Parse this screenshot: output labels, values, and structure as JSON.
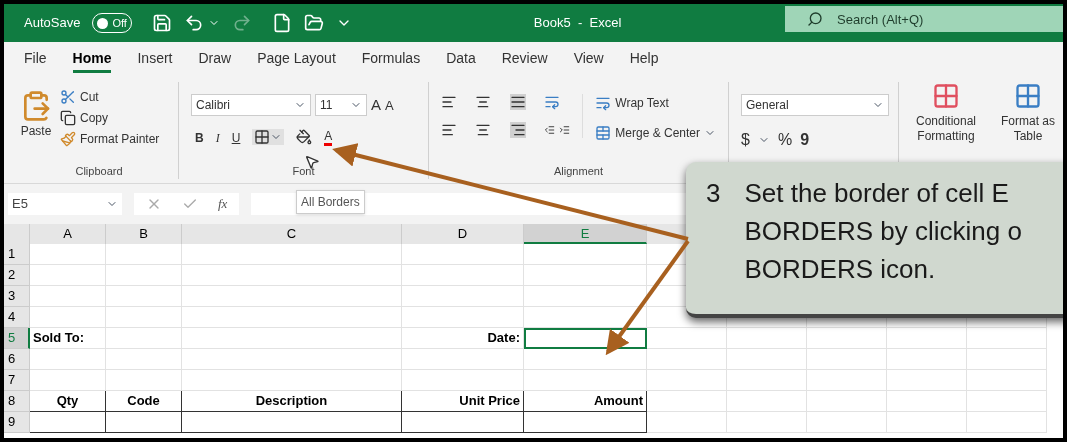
{
  "title_bar": {
    "autosave": "AutoSave",
    "autosave_toggle": {
      "label": "Off",
      "on": false
    },
    "title": "Book5  -  Excel",
    "search": {
      "placeholder": "Search (Alt+Q)"
    }
  },
  "tabs": [
    {
      "label": "File",
      "selected": false
    },
    {
      "label": "Home",
      "selected": true
    },
    {
      "label": "Insert",
      "selected": false
    },
    {
      "label": "Draw",
      "selected": false
    },
    {
      "label": "Page Layout",
      "selected": false
    },
    {
      "label": "Formulas",
      "selected": false
    },
    {
      "label": "Data",
      "selected": false
    },
    {
      "label": "Review",
      "selected": false
    },
    {
      "label": "View",
      "selected": false
    },
    {
      "label": "Help",
      "selected": false
    }
  ],
  "ribbon": {
    "clipboard": {
      "paste": "Paste",
      "cut": "Cut",
      "copy": "Copy",
      "format_painter": "Format Painter",
      "label": "Clipboard"
    },
    "font": {
      "font_name": "Calibri",
      "font_size": "11",
      "grow_font": "A",
      "shrink_font": "A",
      "font_color": "A",
      "bold": "B",
      "italic": "I",
      "underline": "U",
      "label": "Font"
    },
    "alignment": {
      "wrap_text": "Wrap Text",
      "merge_center": "Merge & Center",
      "label": "Alignment"
    },
    "number": {
      "format": "General",
      "currency": "$",
      "percent": "%",
      "comma": "9"
    },
    "styles": {
      "conditional_formatting": "Conditional Formatting",
      "format_as_table": "Format as Table"
    }
  },
  "tooltip": "All Borders",
  "formula_bar": {
    "name_box": "E5",
    "fx": "fx"
  },
  "sheet": {
    "columns": [
      {
        "label": "A",
        "selected": false
      },
      {
        "label": "B",
        "selected": false
      },
      {
        "label": "C",
        "selected": false
      },
      {
        "label": "D",
        "selected": false
      },
      {
        "label": "E",
        "selected": true
      }
    ],
    "rows": [
      {
        "number": "1",
        "selected": false,
        "bordered": false,
        "cells": [
          null,
          null,
          null,
          null,
          null
        ]
      },
      {
        "number": "2",
        "selected": false,
        "bordered": false,
        "cells": [
          null,
          null,
          null,
          null,
          null
        ]
      },
      {
        "number": "3",
        "selected": false,
        "bordered": false,
        "cells": [
          null,
          null,
          null,
          null,
          null
        ]
      },
      {
        "number": "4",
        "selected": false,
        "bordered": false,
        "cells": [
          null,
          null,
          null,
          null,
          null
        ]
      },
      {
        "number": "5",
        "selected": true,
        "bordered": false,
        "cells": [
          {
            "text": "Sold To:"
          },
          null,
          null,
          {
            "text": "Date:"
          },
          {
            "selected": true
          }
        ]
      },
      {
        "number": "6",
        "selected": false,
        "bordered": false,
        "cells": [
          null,
          null,
          null,
          null,
          null
        ]
      },
      {
        "number": "7",
        "selected": false,
        "bordered": false,
        "cells": [
          null,
          null,
          null,
          null,
          null
        ]
      },
      {
        "number": "8",
        "selected": false,
        "bordered": true,
        "cells": [
          {
            "text": "Qty"
          },
          {
            "text": "Code"
          },
          {
            "text": "Description"
          },
          {
            "text": "Unit Price"
          },
          {
            "text": "Amount"
          }
        ]
      },
      {
        "number": "9",
        "selected": false,
        "bordered": true,
        "cells": [
          null,
          null,
          null,
          null,
          null
        ]
      }
    ]
  },
  "callout": {
    "step": "3",
    "text": "Set the border of cell E\nBORDERS by clicking o\nBORDERS icon."
  }
}
